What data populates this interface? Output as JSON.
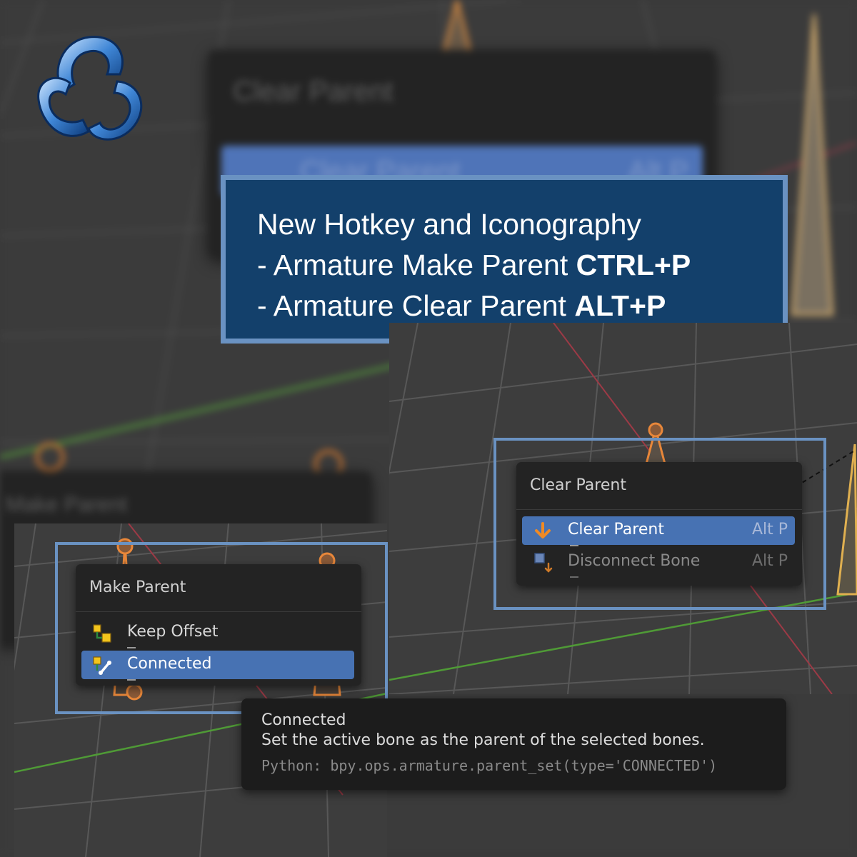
{
  "logo": {
    "icon": "blender-studio-logo-icon"
  },
  "banner": {
    "heading": "New Hotkey and Iconography",
    "line1_prefix": "- Armature Make Parent ",
    "line1_hotkey": "CTRL+P",
    "line2_prefix": "- Armature Clear Parent ",
    "line2_hotkey": "ALT+P"
  },
  "background_menu_top": {
    "title": "Clear Parent",
    "item": "Clear Parent",
    "shortcut": "Alt P"
  },
  "background_menu_left": {
    "title": "Make Parent"
  },
  "clear_parent_menu": {
    "title": "Clear Parent",
    "items": [
      {
        "label": "Clear Parent",
        "shortcut": "Alt P",
        "icon": "arrow-down-icon",
        "state": "active"
      },
      {
        "label": "Disconnect Bone",
        "shortcut": "Alt P",
        "icon": "disconnect-bone-icon",
        "state": "disabled"
      }
    ]
  },
  "make_parent_menu": {
    "title": "Make Parent",
    "items": [
      {
        "label": "Keep Offset",
        "icon": "keep-offset-icon",
        "state": "normal"
      },
      {
        "label": "Connected",
        "icon": "connected-icon",
        "state": "active"
      }
    ]
  },
  "tooltip": {
    "title": "Connected",
    "description": "Set the active bone as the parent of the selected bones.",
    "python": "Python: bpy.ops.armature.parent_set(type='CONNECTED')"
  },
  "colors": {
    "frame": "#6a92c2",
    "banner_bg": "#13406b",
    "menu_bg": "#232323",
    "menu_active": "#4772b3",
    "bone_orange": "#e8873a",
    "x_axis": "#c8424e",
    "y_axis": "#5aa236"
  }
}
